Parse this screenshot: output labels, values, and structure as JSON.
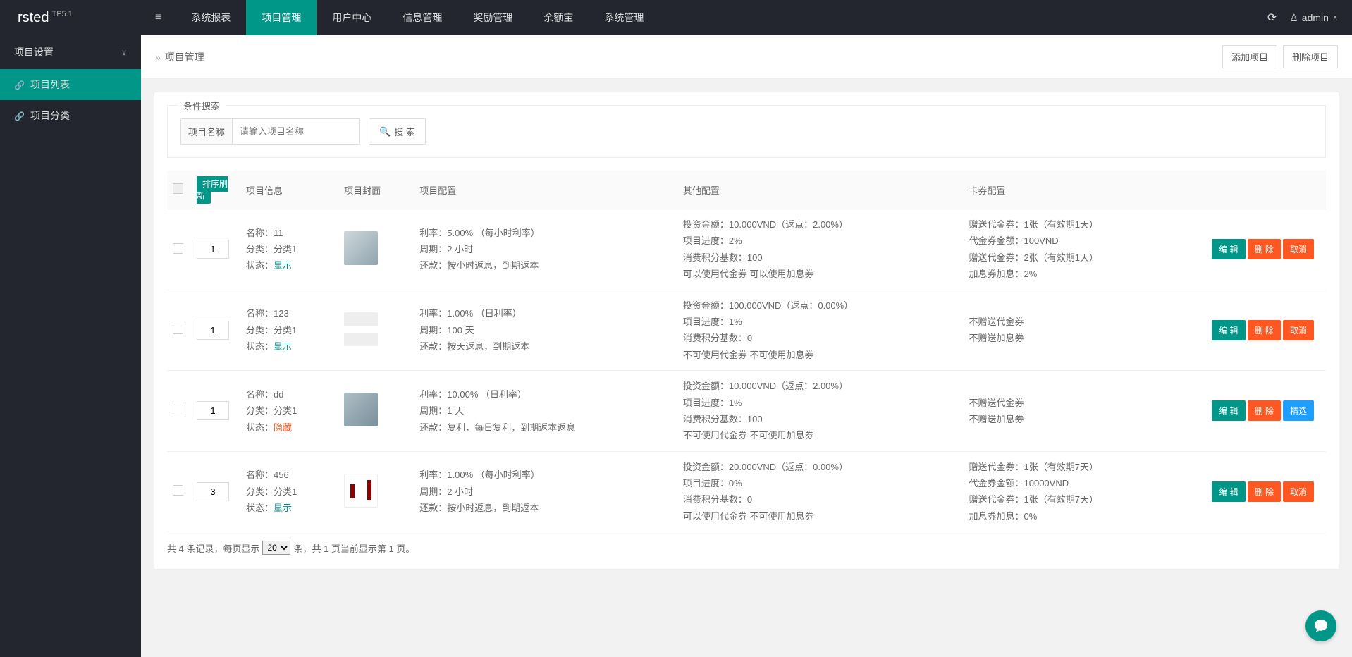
{
  "logo": {
    "main": "rsted",
    "sup": "TP5.1"
  },
  "topNav": [
    "系统报表",
    "项目管理",
    "用户中心",
    "信息管理",
    "奖励管理",
    "余额宝",
    "系统管理"
  ],
  "topNavActive": 1,
  "user": "admin",
  "sidebar": {
    "group": "项目设置",
    "items": [
      "项目列表",
      "项目分类"
    ],
    "activeIndex": 0
  },
  "breadcrumb": "项目管理",
  "actions": {
    "add": "添加项目",
    "del": "删除项目"
  },
  "search": {
    "legend": "条件搜索",
    "label": "项目名称",
    "placeholder": "请输入项目名称",
    "btn": "搜 索"
  },
  "table": {
    "sortRefresh": "排序刷新",
    "headers": [
      "项目信息",
      "项目封面",
      "项目配置",
      "其他配置",
      "卡券配置"
    ],
    "rows": [
      {
        "sort": "1",
        "info": {
          "name": "11",
          "cat": "分类1",
          "status": "显示",
          "statusClass": "status-show"
        },
        "thumbClass": "thumb",
        "cfg": [
          "利率：5.00% （每小时利率）",
          "周期：2 小时",
          "还款：按小时返息，到期返本"
        ],
        "other": [
          "投资金额：10.000VND（返点：2.00%）",
          "项目进度：2%",
          "消费积分基数：100",
          "可以使用代金券   可以使用加息券"
        ],
        "card": [
          "赠送代金券：1张（有效期1天）",
          "代金券金额：100VND",
          "赠送代金券：2张（有效期1天）",
          "加息券加息：2%"
        ],
        "btns": [
          [
            "编 辑",
            "btn-teal"
          ],
          [
            "删 除",
            "btn-orange"
          ],
          [
            "取消",
            "btn-orange"
          ]
        ]
      },
      {
        "sort": "1",
        "info": {
          "name": "123",
          "cat": "分类1",
          "status": "显示",
          "statusClass": "status-show"
        },
        "thumbClass": "thumb thumb2",
        "cfg": [
          "利率：1.00% （日利率）",
          "周期：100 天",
          "还款：按天返息，到期返本"
        ],
        "other": [
          "投资金额：100.000VND（返点：0.00%）",
          "项目进度：1%",
          "消费积分基数：0",
          "不可使用代金券   不可使用加息券"
        ],
        "card": [
          "不赠送代金券",
          "不赠送加息券"
        ],
        "btns": [
          [
            "编 辑",
            "btn-teal"
          ],
          [
            "删 除",
            "btn-orange"
          ],
          [
            "取消",
            "btn-orange"
          ]
        ]
      },
      {
        "sort": "1",
        "info": {
          "name": "dd",
          "cat": "分类1",
          "status": "隐藏",
          "statusClass": "status-hide"
        },
        "thumbClass": "thumb thumb3",
        "cfg": [
          "利率：10.00% （日利率）",
          "周期：1 天",
          "还款：复利，每日复利，到期返本返息"
        ],
        "other": [
          "投资金额：10.000VND（返点：2.00%）",
          "项目进度：1%",
          "消费积分基数：100",
          "不可使用代金券   不可使用加息券"
        ],
        "card": [
          "不赠送代金券",
          "不赠送加息券"
        ],
        "btns": [
          [
            "编 辑",
            "btn-teal"
          ],
          [
            "删 除",
            "btn-orange"
          ],
          [
            "精选",
            "btn-blue"
          ]
        ]
      },
      {
        "sort": "3",
        "info": {
          "name": "456",
          "cat": "分类1",
          "status": "显示",
          "statusClass": "status-show"
        },
        "thumbClass": "thumb thumb4",
        "cfg": [
          "利率：1.00% （每小时利率）",
          "周期：2 小时",
          "还款：按小时返息，到期返本"
        ],
        "other": [
          "投资金额：20.000VND（返点：0.00%）",
          "项目进度：0%",
          "消费积分基数：0",
          "可以使用代金券   不可使用加息券"
        ],
        "card": [
          "赠送代金券：1张（有效期7天）",
          "代金券金额：10000VND",
          "赠送代金券：1张（有效期7天）",
          "加息券加息：0%"
        ],
        "btns": [
          [
            "编 辑",
            "btn-teal"
          ],
          [
            "删 除",
            "btn-orange"
          ],
          [
            "取消",
            "btn-orange"
          ]
        ]
      }
    ]
  },
  "labels": {
    "name": "名称：",
    "cat": "分类：",
    "status": "状态："
  },
  "pager": {
    "pre": "共 4 条记录，每页显示",
    "mid": "条，共 1 页当前显示第 1 页。",
    "pageSize": "20"
  }
}
